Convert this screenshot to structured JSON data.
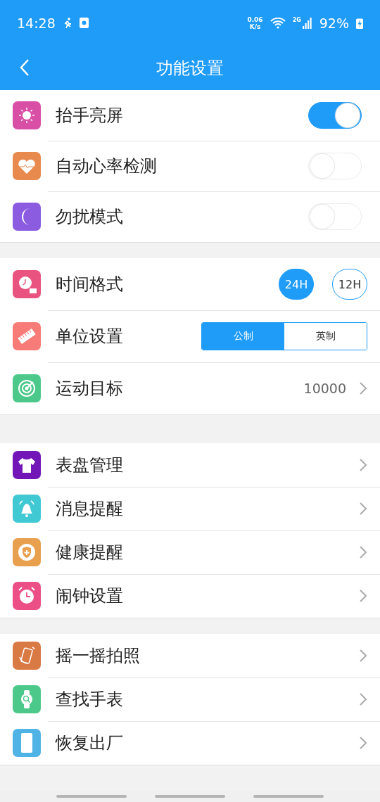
{
  "status_bar": {
    "time": "14:28",
    "speed_value": "0.06",
    "speed_unit": "K/s",
    "network": "2G",
    "battery": "92%"
  },
  "header": {
    "title": "功能设置"
  },
  "groups": [
    {
      "rows": [
        {
          "kind": "toggle",
          "label": "抬手亮屏",
          "color": "#d94fa6",
          "on": true
        },
        {
          "kind": "toggle",
          "label": "自动心率检测",
          "color": "#e8894e",
          "on": false
        },
        {
          "kind": "toggle",
          "label": "勿扰模式",
          "color": "#8b5be0",
          "on": false
        }
      ]
    },
    {
      "rows": [
        {
          "kind": "choice",
          "label": "时间格式",
          "color": "#e9537f",
          "options": [
            {
              "label": "24H",
              "selected": true
            },
            {
              "label": "12H",
              "selected": false
            }
          ]
        },
        {
          "kind": "segment",
          "label": "单位设置",
          "color": "#f77b76",
          "options": [
            {
              "label": "公制",
              "selected": true
            },
            {
              "label": "英制",
              "selected": false
            }
          ]
        },
        {
          "kind": "link",
          "label": "运动目标",
          "color": "#4cc98a",
          "value": "10000"
        }
      ]
    },
    {
      "rows": [
        {
          "kind": "link",
          "label": "表盘管理",
          "color": "#7316b8"
        },
        {
          "kind": "link",
          "label": "消息提醒",
          "color": "#40c8d3"
        },
        {
          "kind": "link",
          "label": "健康提醒",
          "color": "#e8a04e"
        },
        {
          "kind": "link",
          "label": "闹钟设置",
          "color": "#ec4f86"
        }
      ]
    },
    {
      "rows": [
        {
          "kind": "link",
          "label": "摇一摇拍照",
          "color": "#d97a45"
        },
        {
          "kind": "link",
          "label": "查找手表",
          "color": "#4cc98a"
        },
        {
          "kind": "link",
          "label": "恢复出厂",
          "color": "#4fb3e6"
        }
      ]
    }
  ]
}
